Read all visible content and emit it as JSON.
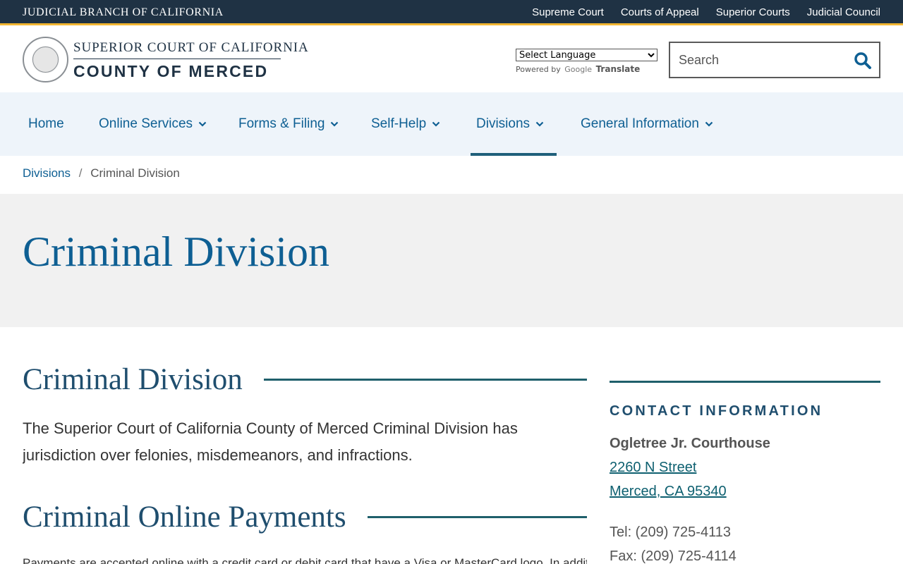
{
  "topbar": {
    "brand": "JUDICIAL BRANCH OF CALIFORNIA",
    "links": [
      "Supreme Court",
      "Courts of Appeal",
      "Superior Courts",
      "Judicial Council"
    ]
  },
  "header": {
    "court_line1": "SUPERIOR COURT OF CALIFORNIA",
    "court_line2": "COUNTY OF MERCED",
    "translate": {
      "select_label": "Select Language",
      "powered_by": "Powered by",
      "google": "Google",
      "translate": "Translate"
    },
    "search": {
      "placeholder": "Search"
    }
  },
  "nav": {
    "items": [
      {
        "label": "Home"
      },
      {
        "label": "Online Services"
      },
      {
        "label": "Forms & Filing"
      },
      {
        "label": "Self-Help"
      },
      {
        "label": "Divisions"
      },
      {
        "label": "General Information"
      }
    ],
    "active": "Divisions"
  },
  "breadcrumb": {
    "parent": "Divisions",
    "separator": "/",
    "current": "Criminal Division"
  },
  "hero": {
    "title": "Criminal Division"
  },
  "main": {
    "sections": [
      {
        "heading": "Criminal Division",
        "text": "The Superior Court of California County of Merced Criminal Division has jurisdiction over felonies, misdemeanors, and infractions."
      },
      {
        "heading": "Criminal Online Payments",
        "text": "Payments are accepted online with a credit card or debit card that have a Visa or MasterCard logo. In addition"
      }
    ]
  },
  "sidebar": {
    "title": "CONTACT INFORMATION",
    "courthouse": "Ogletree Jr. Courthouse",
    "street": "2260 N Street",
    "city": "Merced, CA 95340",
    "tel": "Tel: (209) 725-4113",
    "fax": "Fax: (209) 725-4114"
  },
  "colors": {
    "topbar_bg": "#1f3244",
    "accent_gold": "#f2b632",
    "link_blue": "#0e5f93",
    "nav_bg": "#eef4fa",
    "hero_bg": "#f1f1f1",
    "rule_teal": "#1f5f6b"
  }
}
